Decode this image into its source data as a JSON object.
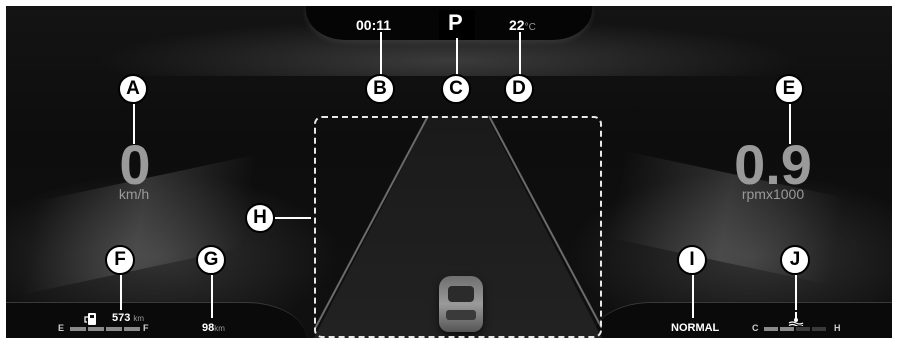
{
  "status_bar": {
    "clock": "00:11",
    "gear": "P",
    "temperature_value": "22",
    "temperature_unit": "°C"
  },
  "speedometer": {
    "value": "0",
    "unit": "km/h"
  },
  "tachometer": {
    "value": "0.9",
    "unit": "rpmx1000"
  },
  "fuel": {
    "range_value": "573",
    "range_unit": "km",
    "empty_label": "E",
    "full_label": "F",
    "level_segments": 4,
    "filled_segments": 4
  },
  "trip": {
    "value": "98",
    "unit": "km"
  },
  "drive_mode": {
    "label": "NORMAL"
  },
  "coolant": {
    "cold_label": "C",
    "hot_label": "H",
    "level_segments": 5,
    "filled_segments": 2
  },
  "callouts": {
    "a": "A",
    "b": "B",
    "c": "C",
    "d": "D",
    "e": "E",
    "f": "F",
    "g": "G",
    "h": "H",
    "i": "I",
    "j": "J"
  },
  "colors": {
    "background": "#0d0d0d",
    "text_primary": "#ffffff",
    "text_dim": "#9a9a9a",
    "frame": "#e8e8e8"
  }
}
